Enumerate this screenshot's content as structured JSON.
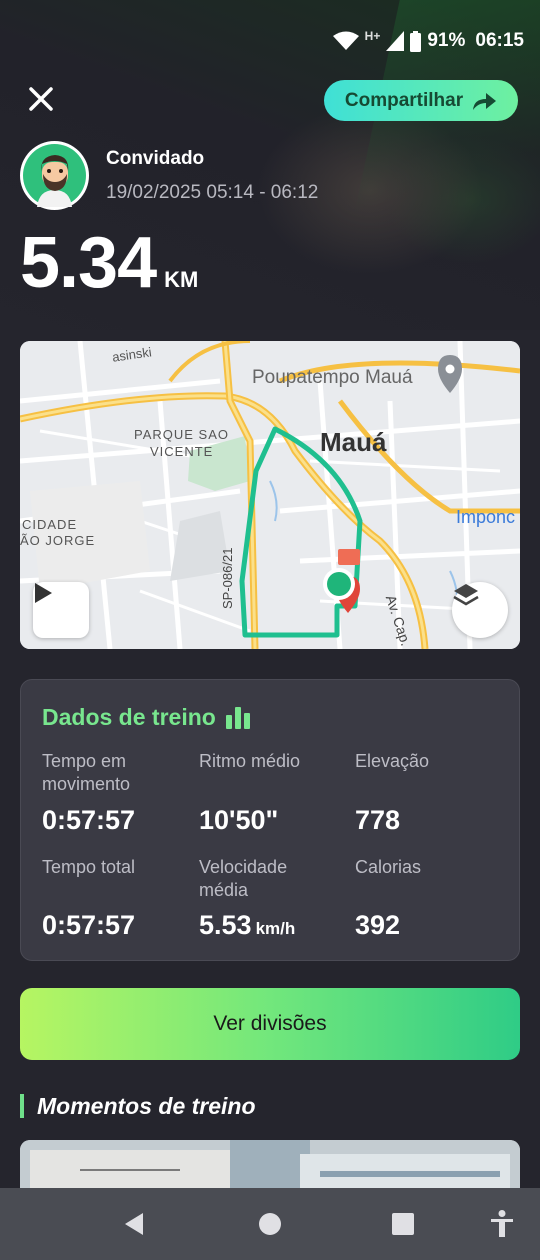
{
  "status_bar": {
    "network": "H+",
    "battery": "91%",
    "time": "06:15",
    "icons": [
      "wifi-icon",
      "signal-icon",
      "battery-icon"
    ]
  },
  "header": {
    "close_icon": "close-icon",
    "share_label": "Compartilhar",
    "share_icon": "share-arrow-icon"
  },
  "user": {
    "name": "Convidado",
    "datetime": "19/02/2025 05:14 - 06:12"
  },
  "distance": {
    "value": "5.34",
    "unit": "KM"
  },
  "map": {
    "labels": {
      "poupatempo": "Poupatempo Mauá",
      "city": "Mauá",
      "parque_1": "PARQUE SAO",
      "parque_2": "VICENTE",
      "cidade_1": "CIDADE",
      "cidade_2": "ÃO JORGE",
      "imponc": "Imponc",
      "road": "SP-086/21",
      "av": "Av. Cap.",
      "street_top": "asinski"
    },
    "route_color": "#1fbf8f"
  },
  "stats": {
    "title": "Dados de treino",
    "moving_time_label": "Tempo em movimento",
    "moving_time_value": "0:57:57",
    "avg_pace_label": "Ritmo médio",
    "avg_pace_value": "10'50\"",
    "elevation_label": "Elevação",
    "elevation_value": "778",
    "total_time_label": "Tempo total",
    "total_time_value": "0:57:57",
    "avg_speed_label": "Velocidade média",
    "avg_speed_value": "5.53",
    "avg_speed_unit": "km/h",
    "calories_label": "Calorias",
    "calories_value": "392"
  },
  "splits_button": "Ver divisões",
  "moments_title": "Momentos de treino",
  "accent_colors": {
    "green": "#78e68e",
    "share_gradient": [
      "#3fe0d6",
      "#6ef0a0"
    ]
  }
}
